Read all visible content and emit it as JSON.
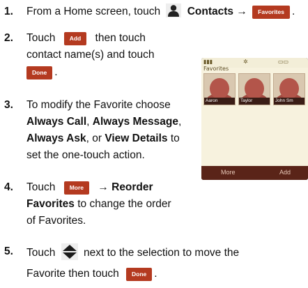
{
  "steps": [
    {
      "number": "1.",
      "text_a": "From a Home screen, touch",
      "bold_a": "Contacts →",
      "button": "Favorites",
      "end": "."
    },
    {
      "number": "2.",
      "text_a": "Touch",
      "button_a": "Add",
      "text_b": "then touch",
      "line2": "contact name(s) and touch",
      "button_b": "Done",
      "end": "."
    },
    {
      "number": "3.",
      "line1": "To modify the Favorite choose",
      "opt1": "Always Call",
      "comma1": ",",
      "opt2": "Always Message",
      "comma2": ",",
      "opt3": "Always Ask",
      "or_text": ", or",
      "opt4": "View  Details",
      "to_text": "to",
      "line4": "set the one-touch action."
    },
    {
      "number": "4.",
      "text_a": "Touch",
      "button": "More",
      "bold_a": "→ Reorder",
      "bold_b": "Favorites",
      "text_b": "to change the order",
      "line3": "of Favorites."
    },
    {
      "number": "5.",
      "text_a": "Touch",
      "text_b": "next to the selection to move the",
      "line2": "Favorite then touch",
      "button": "Done",
      "end": "."
    }
  ],
  "phone": {
    "title": "Favorites",
    "contacts": [
      "Aaron",
      "Taylor",
      "John Sm"
    ],
    "softkeys": {
      "left": "More",
      "right": "Add"
    }
  },
  "colors": {
    "button": "#b43a20",
    "phone_bar": "#5a2418",
    "phone_screen": "#f7f2de"
  },
  "icons": {
    "contacts": "contacts-person-icon",
    "reorder": "up-down-arrow-icon"
  }
}
